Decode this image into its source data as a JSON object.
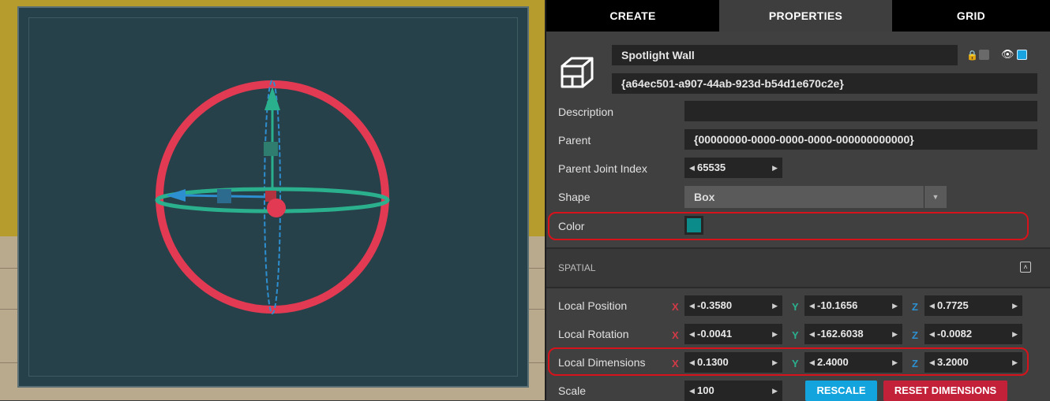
{
  "tabs": [
    {
      "label": "CREATE"
    },
    {
      "label": "PROPERTIES"
    },
    {
      "label": "GRID"
    }
  ],
  "entity": {
    "name": "Spotlight Wall",
    "id": "{a64ec501-a907-44ab-923d-b54d1e670c2e}",
    "icon": "box-entity-icon",
    "locked": false,
    "visible": true
  },
  "fields": {
    "description_label": "Description",
    "description_value": "",
    "parent_label": "Parent",
    "parent_value": "{00000000-0000-0000-0000-000000000000}",
    "parent_joint_label": "Parent Joint Index",
    "parent_joint_value": "65535",
    "shape_label": "Shape",
    "shape_value": "Box",
    "color_label": "Color",
    "color_value": "#0c8b8b"
  },
  "spatial": {
    "section_label": "SPATIAL",
    "rows": [
      {
        "label": "Local Position",
        "x": "-0.3580",
        "y": "-10.1656",
        "z": "0.7725"
      },
      {
        "label": "Local Rotation",
        "x": "-0.0041",
        "y": "-162.6038",
        "z": "-0.0082"
      },
      {
        "label": "Local Dimensions",
        "x": "0.1300",
        "y": "2.4000",
        "z": "3.2000"
      }
    ],
    "axis_labels": {
      "x": "X",
      "y": "Y",
      "z": "Z"
    },
    "scale_label": "Scale",
    "scale_value": "100",
    "rescale_button": "RESCALE",
    "reset_button": "RESET DIMENSIONS"
  },
  "colors": {
    "axis_x": "#d23a46",
    "axis_y": "#2bb08e",
    "axis_z": "#2d8fd0",
    "rescale": "#14a4dd",
    "reset": "#c3203a",
    "highlight": "#d8121b"
  }
}
